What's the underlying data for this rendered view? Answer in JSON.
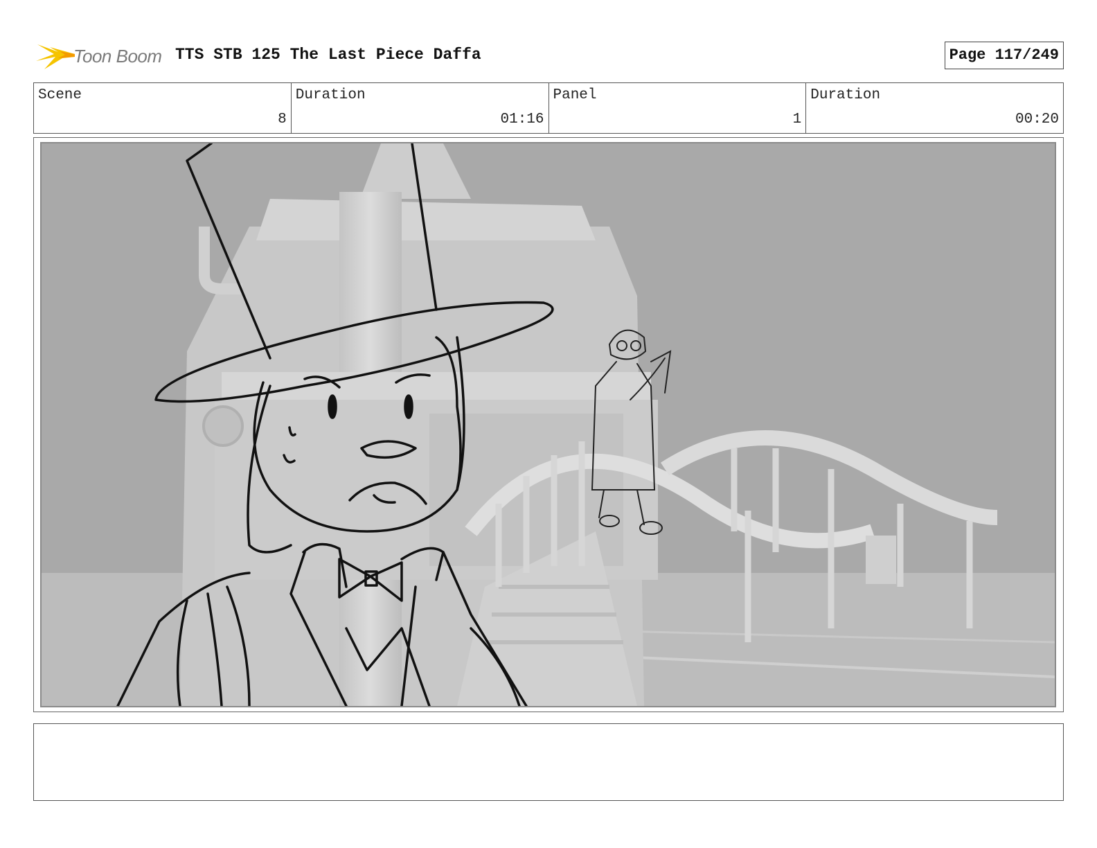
{
  "header": {
    "logo_text": "Toon Boom",
    "title": "TTS STB 125 The Last Piece Daffa",
    "page": "Page 117/249"
  },
  "info": {
    "scene_label": "Scene",
    "scene_value": "8",
    "scene_duration_label": "Duration",
    "scene_duration_value": "01:16",
    "panel_label": "Panel",
    "panel_value": "1",
    "panel_duration_label": "Duration",
    "panel_duration_value": "00:20"
  },
  "notes": {
    "text": ""
  },
  "colors": {
    "background": "#a8a8a8",
    "structure": "#d2d2d2",
    "sketch_line": "#111111",
    "logo_accent": "#f5c400"
  }
}
